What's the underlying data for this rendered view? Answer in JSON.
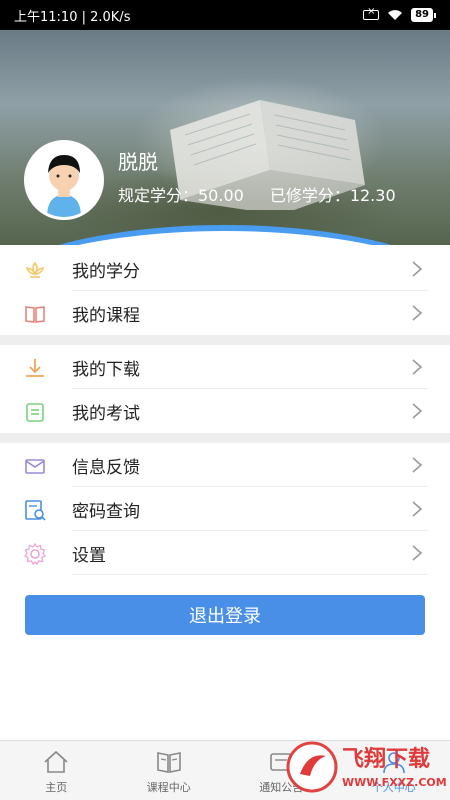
{
  "status_bar": {
    "time_speed": "上午11:10 | 2.0K/s",
    "battery": "89"
  },
  "profile": {
    "name": "脱脱",
    "required_credits": "规定学分：50.00",
    "earned_credits": "已修学分：12.30"
  },
  "menu": {
    "groups": [
      {
        "items": [
          {
            "label": "我的学分",
            "icon": "lotus-icon"
          },
          {
            "label": "我的课程",
            "icon": "book-icon"
          }
        ]
      },
      {
        "items": [
          {
            "label": "我的下载",
            "icon": "download-icon"
          },
          {
            "label": "我的考试",
            "icon": "exam-icon"
          }
        ]
      },
      {
        "items": [
          {
            "label": "信息反馈",
            "icon": "mail-icon"
          },
          {
            "label": "密码查询",
            "icon": "password-search-icon"
          },
          {
            "label": "设置",
            "icon": "gear-icon"
          }
        ]
      }
    ]
  },
  "logout_label": "退出登录",
  "bottom_nav": {
    "items": [
      {
        "label": "主页",
        "icon": "home-icon"
      },
      {
        "label": "课程中心",
        "icon": "book-open-icon"
      },
      {
        "label": "通知公告",
        "icon": "notice-icon"
      },
      {
        "label": "个人中心",
        "icon": "person-icon"
      }
    ]
  },
  "watermark": {
    "brand": "飞翔下载",
    "url": "WWW.FXXZ.COM"
  },
  "colors": {
    "accent": "#4a8fe7",
    "curve_border": "#4a9cf0",
    "icon_yellow": "#f5c86a",
    "icon_red": "#e8857a",
    "icon_orange": "#f0a65a",
    "icon_green": "#7bcf7f",
    "icon_purple": "#9b88d6",
    "icon_blue": "#4a8fe7",
    "icon_pink": "#e8a6d6",
    "watermark_red": "#e03a3a"
  }
}
